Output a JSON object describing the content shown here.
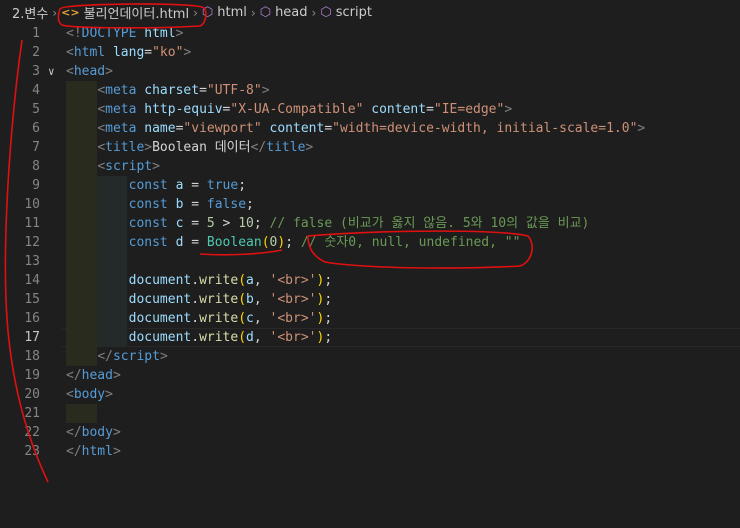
{
  "breadcrumb": {
    "folder": "2.변수",
    "file": "불리언데이터.html",
    "items": [
      "html",
      "head",
      "script"
    ]
  },
  "lines": [
    {
      "n": "1",
      "segs": [
        {
          "t": "<!",
          "c": "t-brk"
        },
        {
          "t": "DOCTYPE",
          "c": "t-tag"
        },
        {
          "t": " html",
          "c": "t-attr"
        },
        {
          "t": ">",
          "c": "t-brk"
        }
      ]
    },
    {
      "n": "2",
      "segs": [
        {
          "t": "<",
          "c": "t-brk"
        },
        {
          "t": "html",
          "c": "t-tag"
        },
        {
          "t": " lang",
          "c": "t-attr"
        },
        {
          "t": "=",
          "c": "t-txt"
        },
        {
          "t": "\"ko\"",
          "c": "t-str"
        },
        {
          "t": ">",
          "c": "t-brk"
        }
      ]
    },
    {
      "n": "3",
      "fold": true,
      "segs": [
        {
          "t": "<",
          "c": "t-brk"
        },
        {
          "t": "head",
          "c": "t-tag"
        },
        {
          "t": ">",
          "c": "t-brk"
        }
      ]
    },
    {
      "n": "4",
      "indent": 1,
      "segs": [
        {
          "t": "    ",
          "c": "t-txt"
        },
        {
          "t": "<",
          "c": "t-brk"
        },
        {
          "t": "meta",
          "c": "t-tag"
        },
        {
          "t": " charset",
          "c": "t-attr"
        },
        {
          "t": "=",
          "c": "t-txt"
        },
        {
          "t": "\"UTF-8\"",
          "c": "t-str"
        },
        {
          "t": ">",
          "c": "t-brk"
        }
      ]
    },
    {
      "n": "5",
      "indent": 1,
      "segs": [
        {
          "t": "    ",
          "c": "t-txt"
        },
        {
          "t": "<",
          "c": "t-brk"
        },
        {
          "t": "meta",
          "c": "t-tag"
        },
        {
          "t": " http-equiv",
          "c": "t-attr"
        },
        {
          "t": "=",
          "c": "t-txt"
        },
        {
          "t": "\"X-UA-Compatible\"",
          "c": "t-str"
        },
        {
          "t": " content",
          "c": "t-attr"
        },
        {
          "t": "=",
          "c": "t-txt"
        },
        {
          "t": "\"IE=edge\"",
          "c": "t-str"
        },
        {
          "t": ">",
          "c": "t-brk"
        }
      ]
    },
    {
      "n": "6",
      "indent": 1,
      "segs": [
        {
          "t": "    ",
          "c": "t-txt"
        },
        {
          "t": "<",
          "c": "t-brk"
        },
        {
          "t": "meta",
          "c": "t-tag"
        },
        {
          "t": " name",
          "c": "t-attr"
        },
        {
          "t": "=",
          "c": "t-txt"
        },
        {
          "t": "\"viewport\"",
          "c": "t-str"
        },
        {
          "t": " content",
          "c": "t-attr"
        },
        {
          "t": "=",
          "c": "t-txt"
        },
        {
          "t": "\"width=device-width, initial-scale=1.0\"",
          "c": "t-str"
        },
        {
          "t": ">",
          "c": "t-brk"
        }
      ]
    },
    {
      "n": "7",
      "indent": 1,
      "segs": [
        {
          "t": "    ",
          "c": "t-txt"
        },
        {
          "t": "<",
          "c": "t-brk"
        },
        {
          "t": "title",
          "c": "t-tag"
        },
        {
          "t": ">",
          "c": "t-brk"
        },
        {
          "t": "Boolean 데이터",
          "c": "t-txt"
        },
        {
          "t": "</",
          "c": "t-brk"
        },
        {
          "t": "title",
          "c": "t-tag"
        },
        {
          "t": ">",
          "c": "t-brk"
        }
      ]
    },
    {
      "n": "8",
      "indent": 1,
      "segs": [
        {
          "t": "    ",
          "c": "t-txt"
        },
        {
          "t": "<",
          "c": "t-brk"
        },
        {
          "t": "script",
          "c": "t-tag"
        },
        {
          "t": ">",
          "c": "t-brk"
        }
      ]
    },
    {
      "n": "9",
      "indent": 2,
      "segs": [
        {
          "t": "        ",
          "c": "t-txt"
        },
        {
          "t": "const",
          "c": "t-kw"
        },
        {
          "t": " a ",
          "c": "t-var"
        },
        {
          "t": "=",
          "c": "t-op"
        },
        {
          "t": " true",
          "c": "t-kw"
        },
        {
          "t": ";",
          "c": "t-op"
        }
      ]
    },
    {
      "n": "10",
      "indent": 2,
      "segs": [
        {
          "t": "        ",
          "c": "t-txt"
        },
        {
          "t": "const",
          "c": "t-kw"
        },
        {
          "t": " b ",
          "c": "t-var"
        },
        {
          "t": "=",
          "c": "t-op"
        },
        {
          "t": " false",
          "c": "t-kw"
        },
        {
          "t": ";",
          "c": "t-op"
        }
      ]
    },
    {
      "n": "11",
      "indent": 2,
      "segs": [
        {
          "t": "        ",
          "c": "t-txt"
        },
        {
          "t": "const",
          "c": "t-kw"
        },
        {
          "t": " c ",
          "c": "t-var"
        },
        {
          "t": "= ",
          "c": "t-op"
        },
        {
          "t": "5",
          "c": "t-num"
        },
        {
          "t": " > ",
          "c": "t-op"
        },
        {
          "t": "10",
          "c": "t-num"
        },
        {
          "t": "; ",
          "c": "t-op"
        },
        {
          "t": "// false (비교가 옳지 않음. 5와 10의 값을 비교)",
          "c": "t-cmt"
        }
      ]
    },
    {
      "n": "12",
      "indent": 2,
      "segs": [
        {
          "t": "        ",
          "c": "t-txt"
        },
        {
          "t": "const",
          "c": "t-kw"
        },
        {
          "t": " d ",
          "c": "t-var"
        },
        {
          "t": "= ",
          "c": "t-op"
        },
        {
          "t": "Boolean",
          "c": "t-cls"
        },
        {
          "t": "(",
          "c": "t-paren"
        },
        {
          "t": "0",
          "c": "t-num"
        },
        {
          "t": ")",
          "c": "t-paren"
        },
        {
          "t": "; ",
          "c": "t-op"
        },
        {
          "t": "// 숫자0, null, undefined, \"\"",
          "c": "t-cmt"
        }
      ]
    },
    {
      "n": "13",
      "indent": 2,
      "segs": []
    },
    {
      "n": "14",
      "indent": 2,
      "segs": [
        {
          "t": "        ",
          "c": "t-txt"
        },
        {
          "t": "document",
          "c": "t-var"
        },
        {
          "t": ".",
          "c": "t-op"
        },
        {
          "t": "write",
          "c": "t-fn"
        },
        {
          "t": "(",
          "c": "t-paren"
        },
        {
          "t": "a",
          "c": "t-var"
        },
        {
          "t": ", ",
          "c": "t-op"
        },
        {
          "t": "'<br>'",
          "c": "t-str"
        },
        {
          "t": ")",
          "c": "t-paren"
        },
        {
          "t": ";",
          "c": "t-op"
        }
      ]
    },
    {
      "n": "15",
      "indent": 2,
      "segs": [
        {
          "t": "        ",
          "c": "t-txt"
        },
        {
          "t": "document",
          "c": "t-var"
        },
        {
          "t": ".",
          "c": "t-op"
        },
        {
          "t": "write",
          "c": "t-fn"
        },
        {
          "t": "(",
          "c": "t-paren"
        },
        {
          "t": "b",
          "c": "t-var"
        },
        {
          "t": ", ",
          "c": "t-op"
        },
        {
          "t": "'<br>'",
          "c": "t-str"
        },
        {
          "t": ")",
          "c": "t-paren"
        },
        {
          "t": ";",
          "c": "t-op"
        }
      ]
    },
    {
      "n": "16",
      "indent": 2,
      "segs": [
        {
          "t": "        ",
          "c": "t-txt"
        },
        {
          "t": "document",
          "c": "t-var"
        },
        {
          "t": ".",
          "c": "t-op"
        },
        {
          "t": "write",
          "c": "t-fn"
        },
        {
          "t": "(",
          "c": "t-paren"
        },
        {
          "t": "c",
          "c": "t-var"
        },
        {
          "t": ", ",
          "c": "t-op"
        },
        {
          "t": "'<br>'",
          "c": "t-str"
        },
        {
          "t": ")",
          "c": "t-paren"
        },
        {
          "t": ";",
          "c": "t-op"
        }
      ]
    },
    {
      "n": "17",
      "indent": 2,
      "active": true,
      "segs": [
        {
          "t": "        ",
          "c": "t-txt"
        },
        {
          "t": "document",
          "c": "t-var"
        },
        {
          "t": ".",
          "c": "t-op"
        },
        {
          "t": "write",
          "c": "t-fn"
        },
        {
          "t": "(",
          "c": "t-paren"
        },
        {
          "t": "d",
          "c": "t-var"
        },
        {
          "t": ", ",
          "c": "t-op"
        },
        {
          "t": "'<br>'",
          "c": "t-str"
        },
        {
          "t": ")",
          "c": "t-paren"
        },
        {
          "t": ";",
          "c": "t-op"
        }
      ]
    },
    {
      "n": "18",
      "indent": 1,
      "segs": [
        {
          "t": "    ",
          "c": "t-txt"
        },
        {
          "t": "</",
          "c": "t-brk"
        },
        {
          "t": "script",
          "c": "t-tag"
        },
        {
          "t": ">",
          "c": "t-brk"
        }
      ]
    },
    {
      "n": "19",
      "segs": [
        {
          "t": "</",
          "c": "t-brk"
        },
        {
          "t": "head",
          "c": "t-tag"
        },
        {
          "t": ">",
          "c": "t-brk"
        }
      ]
    },
    {
      "n": "20",
      "segs": [
        {
          "t": "<",
          "c": "t-brk"
        },
        {
          "t": "body",
          "c": "t-tag"
        },
        {
          "t": ">",
          "c": "t-brk"
        }
      ]
    },
    {
      "n": "21",
      "indent": 1,
      "segs": []
    },
    {
      "n": "22",
      "segs": [
        {
          "t": "</",
          "c": "t-brk"
        },
        {
          "t": "body",
          "c": "t-tag"
        },
        {
          "t": ">",
          "c": "t-brk"
        }
      ]
    },
    {
      "n": "23",
      "segs": [
        {
          "t": "</",
          "c": "t-brk"
        },
        {
          "t": "html",
          "c": "t-tag"
        },
        {
          "t": ">",
          "c": "t-brk"
        }
      ]
    }
  ],
  "colors": {
    "background": "#1e1e1e",
    "annotation": "#e01010"
  }
}
